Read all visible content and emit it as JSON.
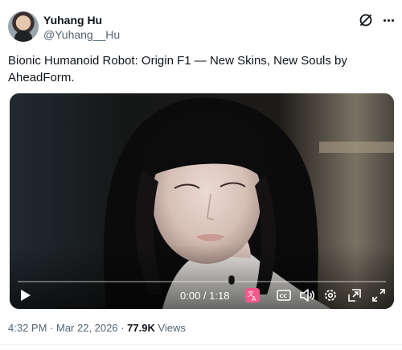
{
  "author": {
    "display_name": "Yuhang Hu",
    "handle": "@Yuhang__Hu"
  },
  "tweet": {
    "text": "Bionic Humanoid Robot: Origin F1 — New Skins, New Souls by AheadForm."
  },
  "video": {
    "time_display": "0:00 / 1:18",
    "progress": 0,
    "controls": [
      "play-icon",
      "captions-translate-icon",
      "cc-icon",
      "volume-icon",
      "settings-icon",
      "picture-in-picture-icon",
      "fullscreen-icon"
    ]
  },
  "meta": {
    "time": "4:32 PM",
    "separator": " · ",
    "date": "Mar 22, 2026",
    "views_count": "77.9K",
    "views_label": " Views"
  },
  "colors": {
    "accent_captions": "#f4578c",
    "text_secondary": "#536471"
  }
}
